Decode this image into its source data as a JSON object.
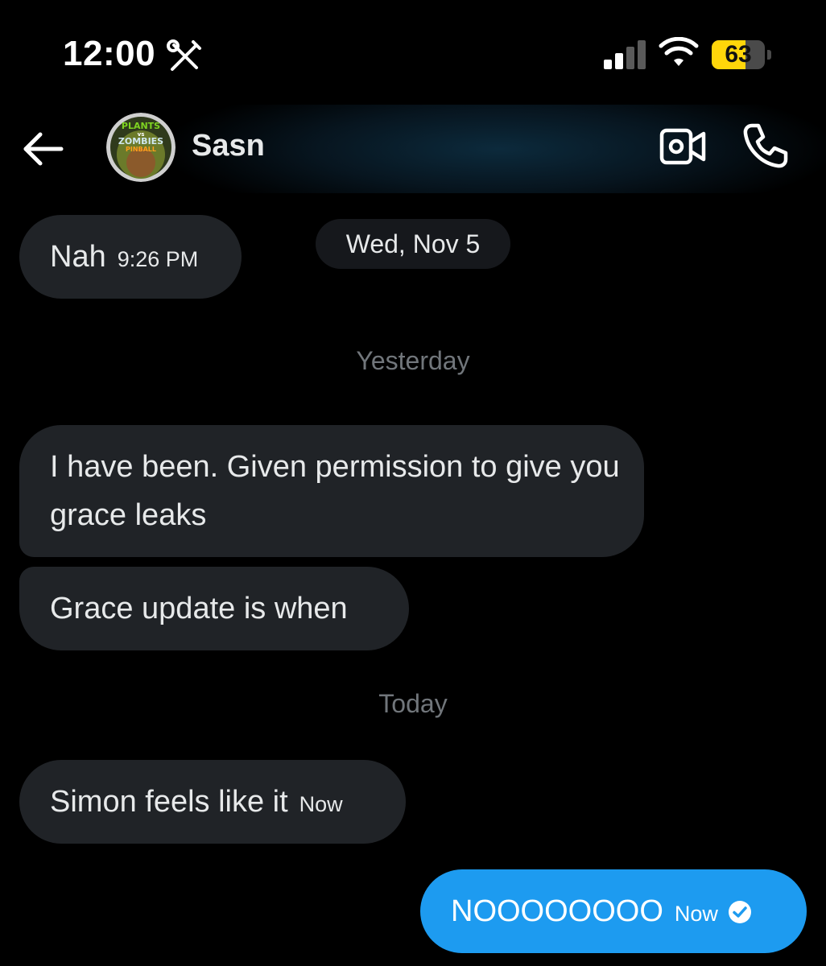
{
  "status_bar": {
    "time": "12:00",
    "battery": "63",
    "battery_level": 0.63,
    "signal_bars_active": 2,
    "signal_bars_total": 4
  },
  "header": {
    "contact_name": "Sasn",
    "avatar_text_1": "PLANTS",
    "avatar_text_2": "vs",
    "avatar_text_3": "ZOMBIES",
    "avatar_text_4": "PINBALL"
  },
  "conversation": {
    "date_pill": "Wed, Nov 5",
    "separator_yesterday": "Yesterday",
    "separator_today": "Today",
    "messages": [
      {
        "text": "Nah",
        "time": "9:26 PM",
        "direction": "incoming"
      },
      {
        "text": "I have been. Given permission to give you grace leaks",
        "time": "",
        "direction": "incoming"
      },
      {
        "text": "Grace update is when",
        "time": "",
        "direction": "incoming"
      },
      {
        "text": "Simon feels like it",
        "time": "Now",
        "direction": "incoming"
      },
      {
        "text": "NOOOOOOOO",
        "time": "Now",
        "direction": "outgoing",
        "status": "read"
      }
    ]
  },
  "colors": {
    "background": "#000000",
    "incoming_bubble": "#202327",
    "outgoing_bubble": "#1d9bf0",
    "battery_fill": "#ffd60a",
    "separator_text": "#71767b"
  },
  "icons": {
    "tools": "tools-icon",
    "signal": "signal-icon",
    "wifi": "wifi-icon",
    "back": "arrow-left-icon",
    "video": "video-call-icon",
    "phone": "phone-icon",
    "check": "check-circle-icon"
  }
}
